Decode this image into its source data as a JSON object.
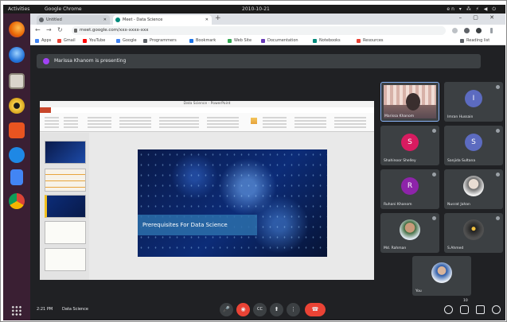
{
  "os": {
    "activities": "Activities",
    "app_menu": "Google Chrome",
    "clock": "2010-10-21",
    "tray": "en ▾ ⁂ ⚡ ◀ ⏻"
  },
  "browser": {
    "tabs": [
      {
        "label": "Untitled",
        "favicon_color": "#5f6368"
      },
      {
        "label": "Meet - Data Science",
        "favicon_color": "#00897b"
      }
    ],
    "new_tab": "+",
    "window_controls": "– ▢ ✕",
    "url": "meet.google.com/xxx-xxxx-xxx",
    "bookmarks": [
      {
        "label": "Apps",
        "color": "#4285f4"
      },
      {
        "label": "Gmail",
        "color": "#ea4335"
      },
      {
        "label": "YouTube",
        "color": "#ff0000"
      },
      {
        "label": "Google",
        "color": "#4285f4"
      },
      {
        "label": "Programmers",
        "color": "#5f6368"
      },
      {
        "label": "Bookmark",
        "color": "#1a73e8"
      },
      {
        "label": "Web Site",
        "color": "#34a853"
      },
      {
        "label": "Documentation",
        "color": "#673ab7"
      },
      {
        "label": "Notebooks",
        "color": "#00897b"
      },
      {
        "label": "Resources",
        "color": "#ea4335"
      },
      {
        "label": "Reading list",
        "color": "#5f6368"
      }
    ]
  },
  "meet": {
    "presenting_banner": "Marissa Khanom is presenting",
    "slide_title": "Prerequisites For Data Science",
    "ppt_window_title": "Data Science - PowerPoint",
    "participants": [
      {
        "name": "Marissa Khanom",
        "kind": "camera"
      },
      {
        "name": "Imran Hussain",
        "initial": "I",
        "color": "#5c6bc0"
      },
      {
        "name": "Shahinoor Shelley",
        "initial": "S",
        "color": "#d81b60"
      },
      {
        "name": "Sanjida Sultana",
        "initial": "S",
        "color": "#5c6bc0"
      },
      {
        "name": "Ruhani Khanom",
        "initial": "R",
        "color": "#8e24aa"
      },
      {
        "name": "Nusrat Jahan",
        "kind": "photo"
      },
      {
        "name": "Md. Rahman",
        "kind": "photo"
      },
      {
        "name": "S.Ahmed",
        "kind": "photo"
      },
      {
        "name": "You",
        "kind": "photo"
      }
    ],
    "meeting_time": "2:21 PM",
    "meeting_code": "Data Science",
    "participant_count": "10",
    "controls": {
      "mic": "🎤",
      "camera": "◉",
      "captions": "CC",
      "present": "⬆",
      "more": "⋮",
      "end": "☎"
    }
  }
}
